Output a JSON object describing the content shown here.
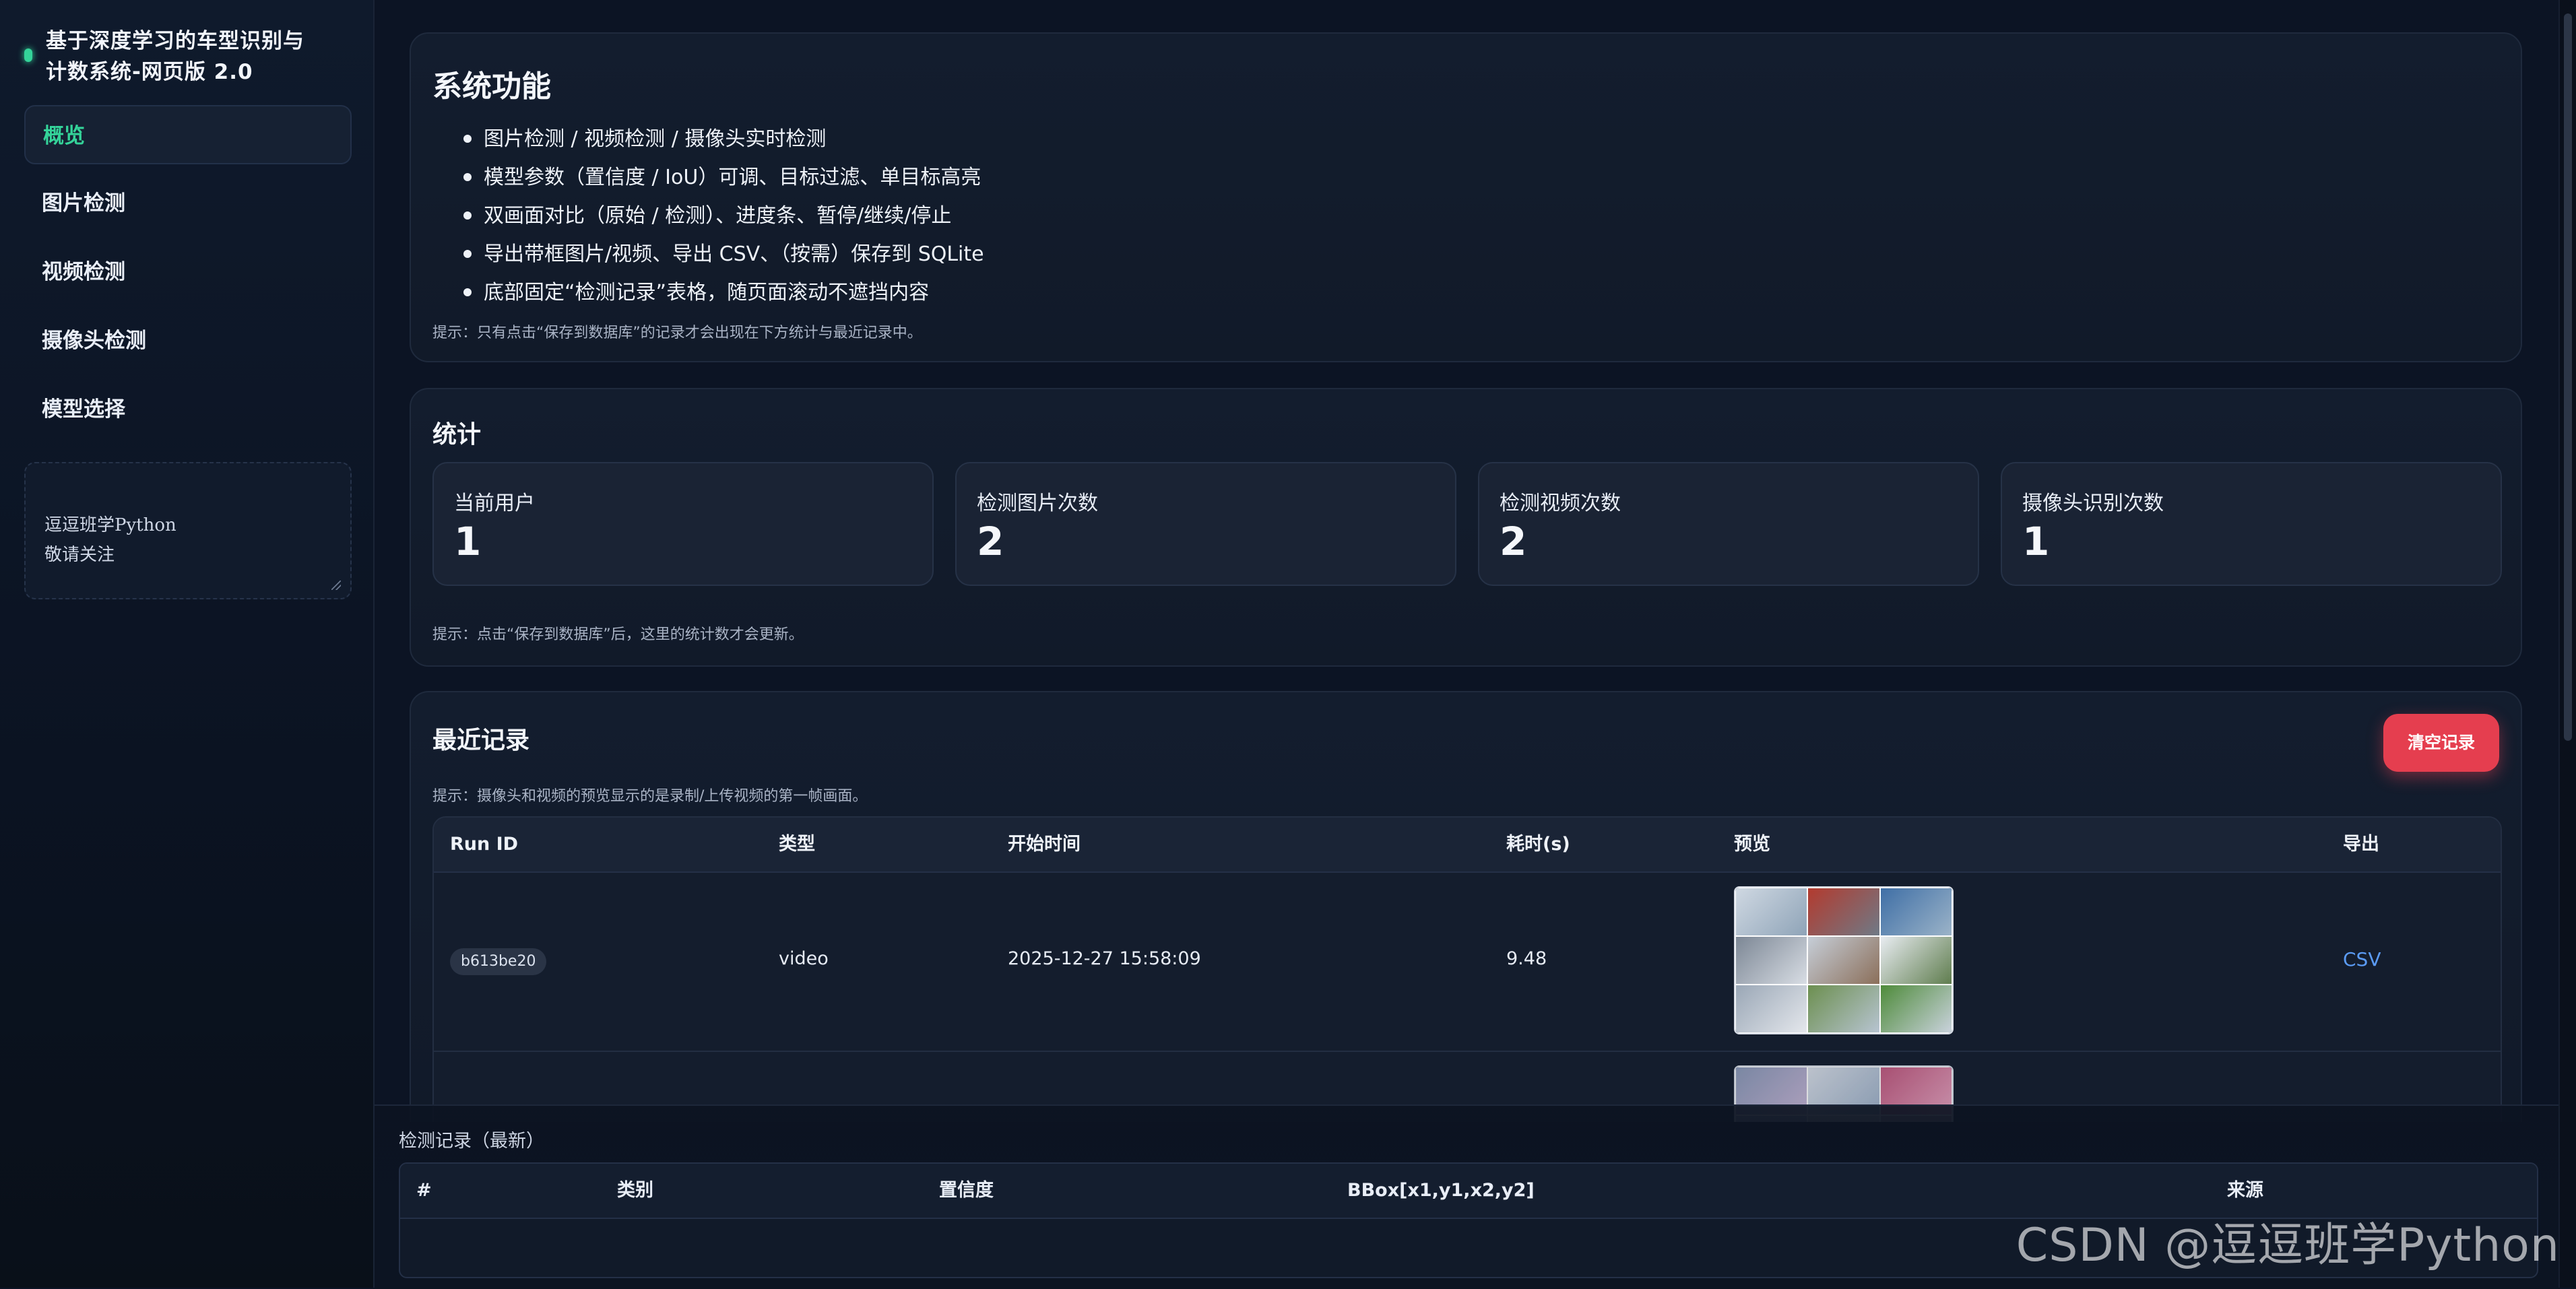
{
  "sidebar": {
    "brand_title": "基于深度学习的车型识别与\n计数系统-网页版 2.0",
    "nav": [
      {
        "label": "概览",
        "active": true
      },
      {
        "label": "图片检测",
        "active": false
      },
      {
        "label": "视频检测",
        "active": false
      },
      {
        "label": "摄像头检测",
        "active": false
      },
      {
        "label": "模型选择",
        "active": false
      }
    ],
    "notes_text": "逗逗班学Python\n敬请关注"
  },
  "features": {
    "title": "系统功能",
    "items": [
      "图片检测 / 视频检测 / 摄像头实时检测",
      "模型参数（置信度 / IoU）可调、目标过滤、单目标高亮",
      "双画面对比（原始 / 检测）、进度条、暂停/继续/停止",
      "导出带框图片/视频、导出 CSV、（按需）保存到 SQLite",
      "底部固定“检测记录”表格，随页面滚动不遮挡内容"
    ],
    "hint": "提示：只有点击“保存到数据库”的记录才会出现在下方统计与最近记录中。"
  },
  "stats": {
    "title": "统计",
    "boxes": [
      {
        "label": "当前用户",
        "value": "1"
      },
      {
        "label": "检测图片次数",
        "value": "2"
      },
      {
        "label": "检测视频次数",
        "value": "2"
      },
      {
        "label": "摄像头识别次数",
        "value": "1"
      }
    ],
    "hint": "提示：点击“保存到数据库”后，这里的统计数才会更新。"
  },
  "recent": {
    "title": "最近记录",
    "clear_label": "清空记录",
    "hint": "提示：摄像头和视频的预览显示的是录制/上传视频的第一帧画面。",
    "columns": [
      "Run ID",
      "类型",
      "开始时间",
      "耗时(s)",
      "预览",
      "导出"
    ],
    "rows": [
      {
        "run_id": "b613be20",
        "type": "video",
        "start_time": "2025-12-27 15:58:09",
        "duration": "9.48",
        "export": "CSV"
      }
    ]
  },
  "dock": {
    "title": "检测记录（最新）",
    "columns": [
      "#",
      "类别",
      "置信度",
      "BBox[x1,y1,x2,y2]",
      "来源"
    ]
  },
  "watermark": "CSDN @逗逗班学Python",
  "colors": {
    "accent": "#34d399",
    "danger": "#e53e4f",
    "link": "#5b9bf4",
    "bg": "#0c1424"
  }
}
